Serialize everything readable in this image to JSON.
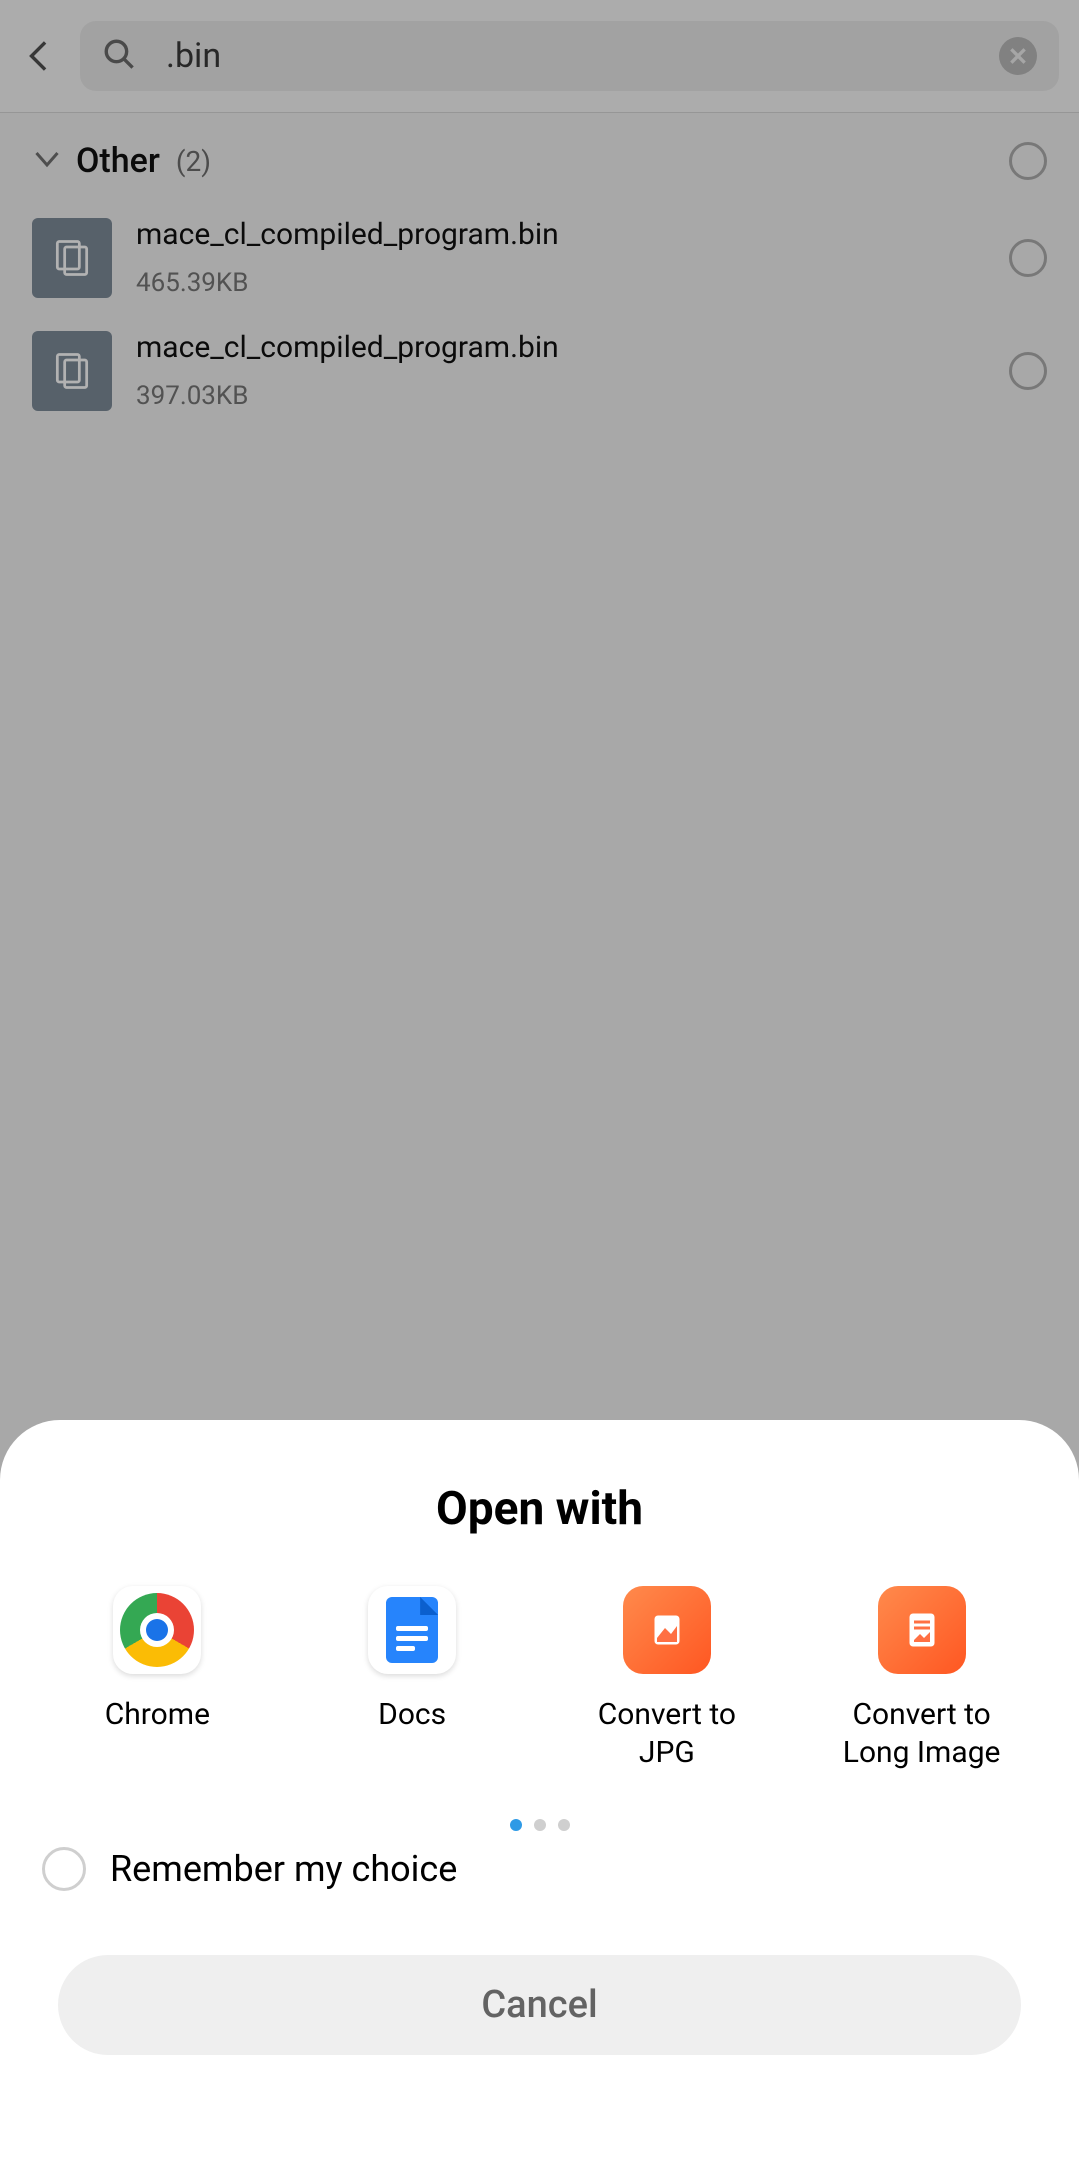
{
  "search": {
    "query": ".bin"
  },
  "section": {
    "title": "Other",
    "count": "(2)"
  },
  "files": [
    {
      "name": "mace_cl_compiled_program.bin",
      "size": "465.39KB"
    },
    {
      "name": "mace_cl_compiled_program.bin",
      "size": "397.03KB"
    }
  ],
  "sheet": {
    "title": "Open with",
    "apps": [
      {
        "label": "Chrome"
      },
      {
        "label": "Docs"
      },
      {
        "label": "Convert to JPG"
      },
      {
        "label": "Convert to Long Image"
      }
    ],
    "remember": "Remember my choice",
    "cancel": "Cancel"
  }
}
